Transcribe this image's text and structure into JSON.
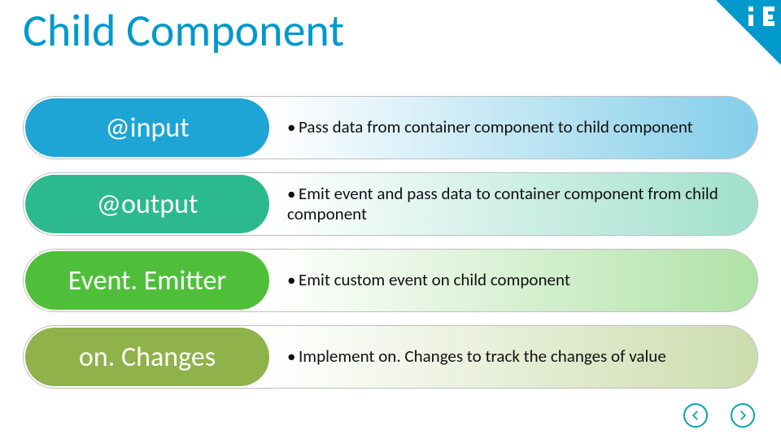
{
  "title": "Child Component",
  "items": [
    {
      "label": "@input",
      "desc": "Pass data from container component to child component",
      "pill_color": "#1ea5d6",
      "grad_from": "rgba(30,165,214,0.0)",
      "grad_to": "rgba(30,165,214,0.55)"
    },
    {
      "label": "@output",
      "desc": "Emit event and pass data to container component from child component",
      "pill_color": "#2cb98e",
      "grad_from": "rgba(44,185,142,0.0)",
      "grad_to": "rgba(44,185,142,0.45)"
    },
    {
      "label": "Event. Emitter",
      "desc": "Emit custom event on  child component",
      "pill_color": "#4fbf3a",
      "grad_from": "rgba(79,191,58,0.0)",
      "grad_to": "rgba(79,191,58,0.45)"
    },
    {
      "label": "on. Changes",
      "desc": "Implement on. Changes to track the changes of value",
      "pill_color": "#8fb24a",
      "grad_from": "rgba(143,178,74,0.0)",
      "grad_to": "rgba(143,178,74,0.45)"
    }
  ],
  "brand_color": "#0099cc"
}
